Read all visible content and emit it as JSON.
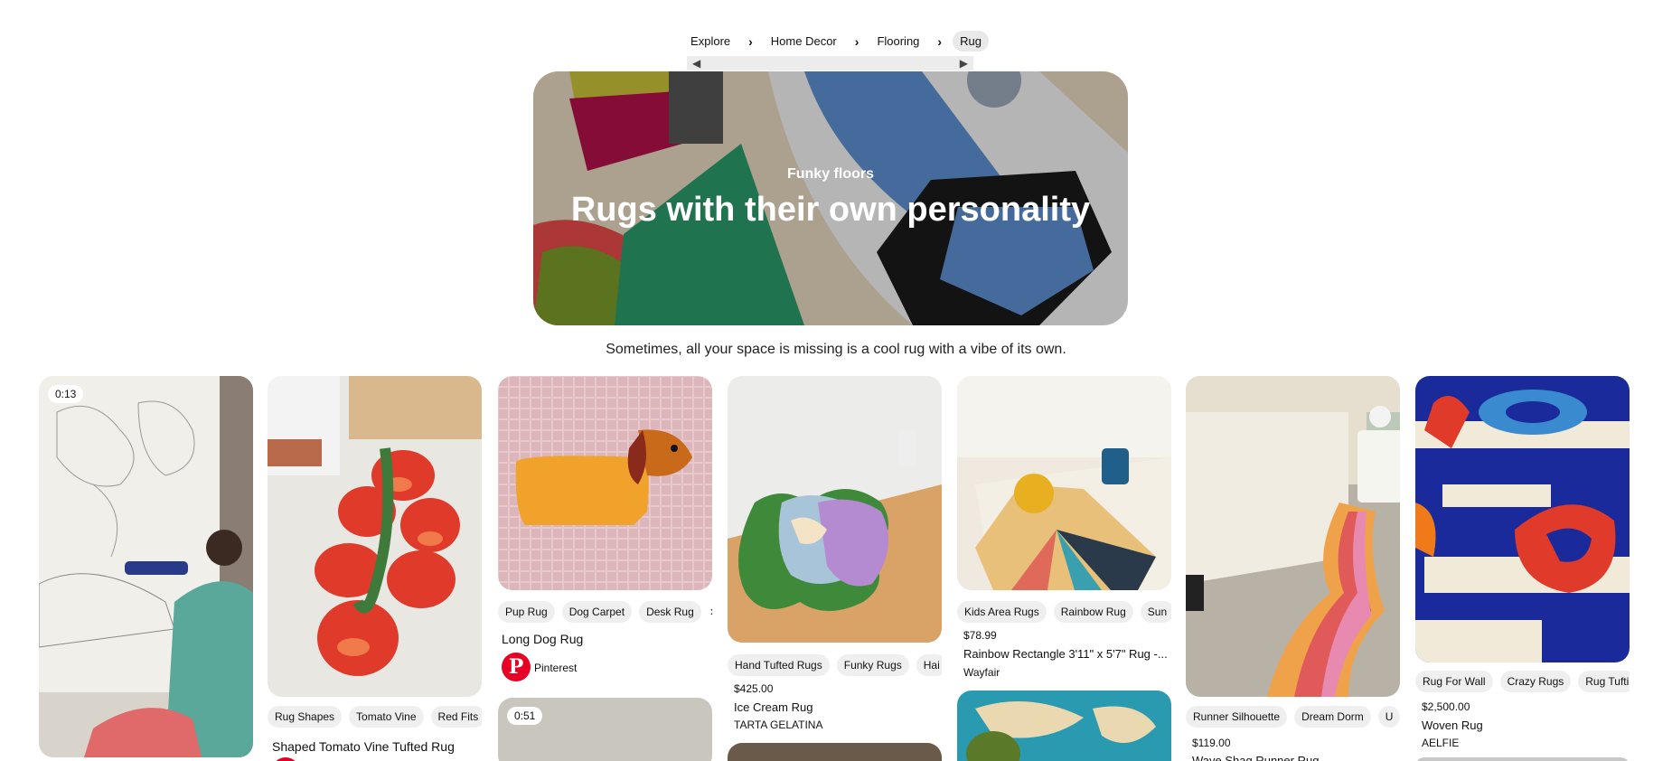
{
  "breadcrumb": [
    "Explore",
    "Home Decor",
    "Flooring",
    "Rug"
  ],
  "hero": {
    "subtitle": "Funky floors",
    "title": "Rugs with their own personality"
  },
  "description": "Sometimes, all your space is missing is a cool rug with a vibe of its own.",
  "pins": [
    {
      "duration": "0:13"
    },
    {
      "chips": [
        "Rug Shapes",
        "Tomato Vine",
        "Red Fits"
      ],
      "title": "Shaped Tomato Vine Tufted Rug"
    },
    {
      "chips": [
        "Pup Rug",
        "Dog Carpet",
        "Desk Rug"
      ],
      "title": "Long Dog Rug",
      "source": "Pinterest"
    },
    {
      "chips": [
        "Hand Tufted Rugs",
        "Funky Rugs",
        "Hai"
      ],
      "price": "$425.00",
      "title": "Ice Cream Rug",
      "seller": "TARTA GELATINA"
    },
    {
      "chips": [
        "Kids Area Rugs",
        "Rainbow Rug",
        "Sun"
      ],
      "price": "$78.99",
      "title": "Rainbow Rectangle 3'11\" x 5'7\" Rug -...",
      "seller": "Wayfair"
    },
    {
      "chips": [
        "Runner Silhouette",
        "Dream Dorm",
        "U"
      ],
      "price": "$119.00",
      "title": "Wave Shag Runner Rug"
    },
    {
      "chips": [
        "Rug For Wall",
        "Crazy Rugs",
        "Rug Tufti"
      ],
      "price": "$2,500.00",
      "title": "Woven Rug",
      "seller": "AELFIE"
    },
    {
      "duration": "0:51"
    }
  ],
  "colors": {
    "pinterest_red": "#e60023",
    "chip_bg": "#efefef"
  }
}
